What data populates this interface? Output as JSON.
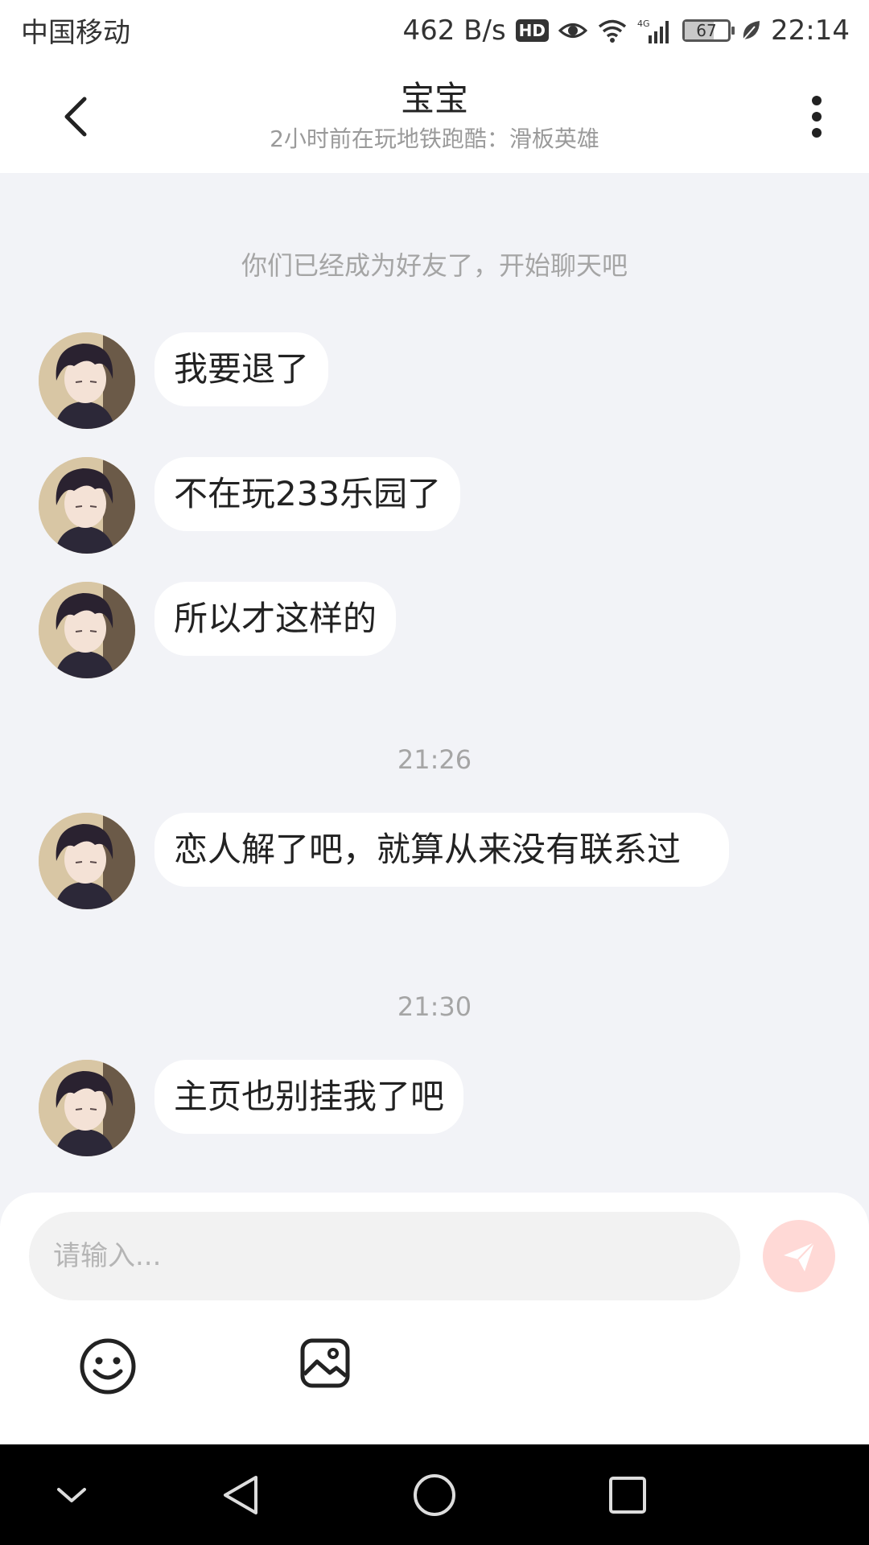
{
  "status_bar": {
    "carrier": "中国移动",
    "network_speed": "462 B/s",
    "hd_label": "HD",
    "network_type": "4G",
    "battery_level": "67",
    "time": "22:14"
  },
  "header": {
    "title": "宝宝",
    "subtitle": "2小时前在玩地铁跑酷：滑板英雄"
  },
  "chat": {
    "system_message": "你们已经成为好友了，开始聊天吧",
    "timestamp_1": "21:26",
    "timestamp_2": "21:30",
    "messages": [
      {
        "text": "我要退了"
      },
      {
        "text": "不在玩233乐园了"
      },
      {
        "text": "所以才这样的"
      },
      {
        "text": "恋人解了吧，就算从来没有联系过"
      },
      {
        "text": "主页也别挂我了吧"
      }
    ]
  },
  "input": {
    "placeholder": "请输入..."
  },
  "colors": {
    "send_button_bg": "#ffd9d6",
    "chat_background": "#f2f3f7",
    "bubble_background": "#ffffff"
  },
  "icons": {
    "back": "chevron-left-icon",
    "more": "more-vertical-icon",
    "send": "send-icon",
    "emoji": "emoji-icon",
    "image": "image-icon"
  }
}
